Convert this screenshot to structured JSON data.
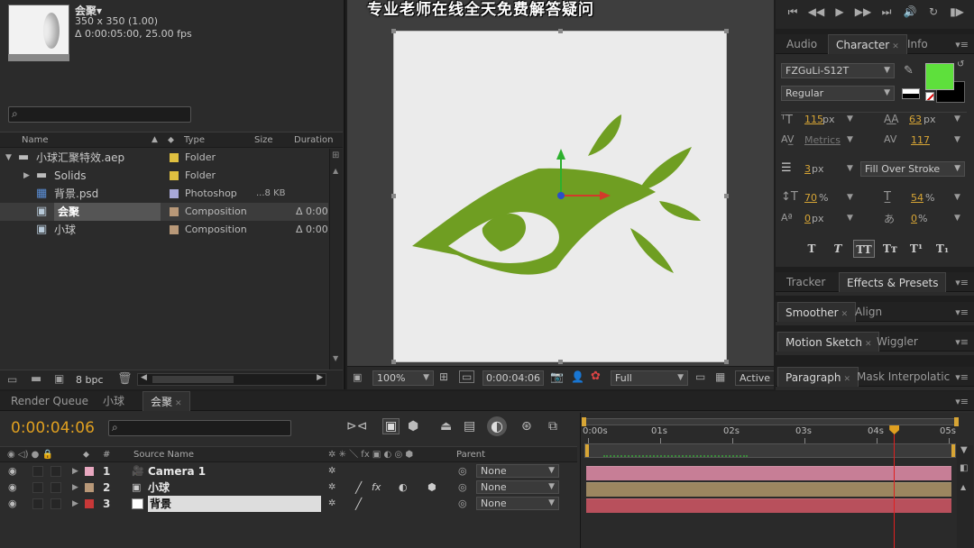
{
  "project": {
    "comp_name": "会聚▾",
    "comp_size": "350 x 350 (1.00)",
    "comp_duration": "Δ 0:00:05:00, 25.00 fps",
    "columns": [
      "Name",
      "Type",
      "Size",
      "Duration"
    ],
    "items": [
      {
        "name": "小球汇聚特效.aep",
        "type": "Folder",
        "size": "",
        "duration": "",
        "color": "#e0c040",
        "indent": 0,
        "twirl": "▼"
      },
      {
        "name": "Solids",
        "type": "Folder",
        "size": "",
        "duration": "",
        "color": "#e0c040",
        "indent": 1,
        "twirl": "▶"
      },
      {
        "name": "背景.psd",
        "type": "Photoshop",
        "size": "...8 KB",
        "duration": "",
        "color": "#a8a8d8",
        "indent": 1,
        "twirl": ""
      },
      {
        "name": "会聚",
        "type": "Composition",
        "size": "",
        "duration": "Δ 0:00",
        "color": "#b89878",
        "indent": 1,
        "twirl": "",
        "selected": true
      },
      {
        "name": "小球",
        "type": "Composition",
        "size": "",
        "duration": "Δ 0:00",
        "color": "#b89878",
        "indent": 1,
        "twirl": ""
      }
    ],
    "bpc": "8 bpc"
  },
  "viewer": {
    "banner": "专业老师在线全天免费解答疑问",
    "zoom": "100%",
    "timecode": "0:00:04:06",
    "resolution": "Full",
    "camera": "Active"
  },
  "preview_buttons": [
    "⏮",
    "◀◀",
    "▶",
    "▶▶",
    "⏭",
    "🔊",
    "↻",
    "▮▶"
  ],
  "character": {
    "tabs": [
      "Audio",
      "Character",
      "Info"
    ],
    "font": "FZGuLi-S12T",
    "style": "Regular",
    "fill_color": "#5ee03c",
    "stroke_color": "#000000",
    "font_size": "115",
    "font_size_unit": "px",
    "leading": "63",
    "leading_unit": "px",
    "kerning": "Metrics",
    "tracking": "117",
    "stroke_width": "3",
    "stroke_unit": "px",
    "stroke_mode": "Fill Over Stroke",
    "vscale": "70",
    "hscale": "54",
    "baseline": "0",
    "baseline_unit": "px",
    "tsume": "0",
    "pct": "%",
    "style_buttons": [
      "T",
      "T",
      "TT",
      "Tт",
      "T¹",
      "T₁"
    ]
  },
  "side_tabs": {
    "row1": [
      "Tracker",
      "Effects & Presets"
    ],
    "row2": [
      "Smoother",
      "Align"
    ],
    "row3": [
      "Motion Sketch",
      "Wiggler"
    ],
    "row4": [
      "Paragraph",
      "Mask Interpolatic"
    ]
  },
  "timeline": {
    "tabs": [
      "Render Queue",
      "小球",
      "会聚"
    ],
    "timecode": "0:00:04:06",
    "ruler": [
      "0:00s",
      "01s",
      "02s",
      "03s",
      "04s",
      "05s"
    ],
    "columns": {
      "num": "#",
      "source": "Source Name",
      "parent": "Parent"
    },
    "playhead_seconds": 4.24,
    "duration_seconds": 5,
    "layers": [
      {
        "num": "1",
        "name": "Camera 1",
        "label": "#e8a8c0",
        "parent": "None",
        "bar": "#c77e96",
        "kind": "camera"
      },
      {
        "num": "2",
        "name": "小球",
        "label": "#b89878",
        "parent": "None",
        "bar": "#9c8660",
        "kind": "comp"
      },
      {
        "num": "3",
        "name": "背景",
        "label": "#c83838",
        "parent": "None",
        "bar": "#b8505c",
        "kind": "solid",
        "selected": true
      }
    ]
  }
}
